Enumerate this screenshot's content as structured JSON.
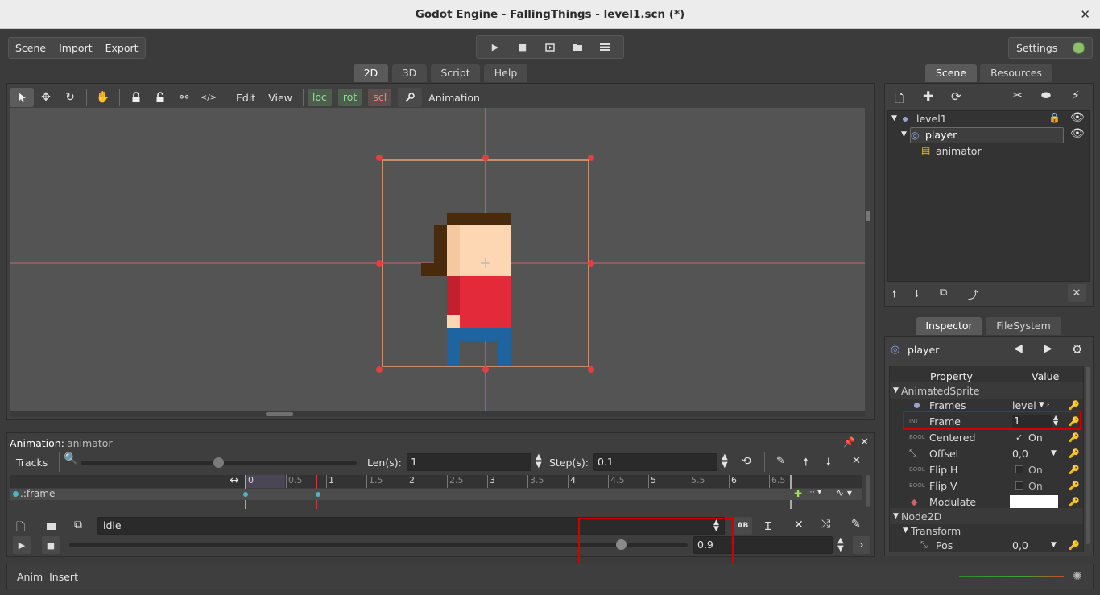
{
  "window": {
    "title": "Godot Engine - FallingThings - level1.scn (*)",
    "close": "✕"
  },
  "menu": [
    "Scene",
    "Import",
    "Export"
  ],
  "play_buttons": [
    "play-icon",
    "stop-icon",
    "play-scene-icon",
    "play-custom-icon",
    "movie-icon"
  ],
  "settings": {
    "label": "Settings"
  },
  "main_tabs": [
    "2D",
    "3D",
    "Script",
    "Help"
  ],
  "toolbar": {
    "edit": "Edit",
    "view": "View",
    "loc": "loc",
    "rot": "rot",
    "scl": "scl",
    "animation": "Animation"
  },
  "anim": {
    "label": "Animation:",
    "node": "animator",
    "tracks": "Tracks",
    "len_label": "Len(s):",
    "len": "1",
    "step_label": "Step(s):",
    "step": "0.1",
    "track_name": ".:frame",
    "anim_name": "idle",
    "position": "0.9",
    "ruler": [
      "0",
      "0.5",
      "1",
      "1.5",
      "2",
      "2.5",
      "3",
      "3.5",
      "4",
      "4.5",
      "5",
      "5.5",
      "6",
      "6.5"
    ]
  },
  "status": {
    "anim": "Anim",
    "insert": "Insert"
  },
  "scene_tabs": [
    "Scene",
    "Resources"
  ],
  "tree": {
    "root": "level1",
    "player": "player",
    "animator": "animator"
  },
  "inspector_tabs": [
    "Inspector",
    "FileSystem"
  ],
  "inspector": {
    "object": "player",
    "col_property": "Property",
    "col_value": "Value",
    "sec_sprite": "AnimatedSprite",
    "sec_node2d": "Node2D",
    "sec_transform": "Transform",
    "frames": "Frames",
    "frames_val": "level",
    "frame": "Frame",
    "frame_val": "1",
    "frame_hint": "INT",
    "centered": "Centered",
    "on": "On",
    "bool": "BOOL",
    "offset": "Offset",
    "offset_val": "0,0",
    "fliph": "Flip H",
    "flipv": "Flip V",
    "modulate": "Modulate",
    "pos": "Pos",
    "pos_val": "0,0"
  }
}
